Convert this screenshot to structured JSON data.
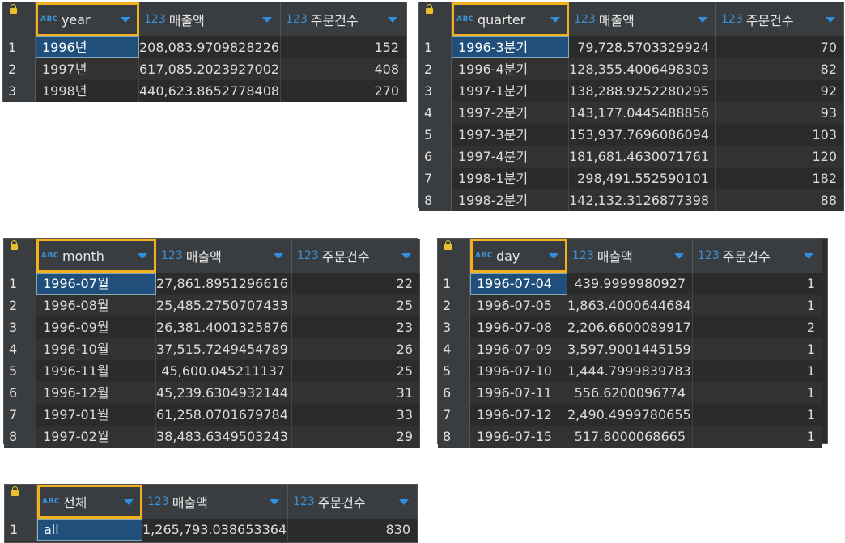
{
  "grids": {
    "year": {
      "col1_type": "ABC",
      "col1_name": "year",
      "col2_type": "123",
      "col2_name": "매출액",
      "col3_type": "123",
      "col3_name": "주문건수",
      "rows": [
        {
          "n": "1",
          "a": "1996년",
          "b": "208,083.9709828226",
          "c": "152"
        },
        {
          "n": "2",
          "a": "1997년",
          "b": "617,085.2023927002",
          "c": "408"
        },
        {
          "n": "3",
          "a": "1998년",
          "b": "440,623.8652778408",
          "c": "270"
        }
      ]
    },
    "quarter": {
      "col1_type": "ABC",
      "col1_name": "quarter",
      "col2_type": "123",
      "col2_name": "매출액",
      "col3_type": "123",
      "col3_name": "주문건수",
      "rows": [
        {
          "n": "1",
          "a": "1996-3분기",
          "b": "79,728.5703329924",
          "c": "70"
        },
        {
          "n": "2",
          "a": "1996-4분기",
          "b": "128,355.4006498303",
          "c": "82"
        },
        {
          "n": "3",
          "a": "1997-1분기",
          "b": "138,288.9252280295",
          "c": "92"
        },
        {
          "n": "4",
          "a": "1997-2분기",
          "b": "143,177.0445488856",
          "c": "93"
        },
        {
          "n": "5",
          "a": "1997-3분기",
          "b": "153,937.7696086094",
          "c": "103"
        },
        {
          "n": "6",
          "a": "1997-4분기",
          "b": "181,681.4630071761",
          "c": "120"
        },
        {
          "n": "7",
          "a": "1998-1분기",
          "b": "298,491.552590101",
          "c": "182"
        },
        {
          "n": "8",
          "a": "1998-2분기",
          "b": "142,132.3126877398",
          "c": "88"
        }
      ]
    },
    "month": {
      "col1_type": "ABC",
      "col1_name": "month",
      "col2_type": "123",
      "col2_name": "매출액",
      "col3_type": "123",
      "col3_name": "주문건수",
      "rows": [
        {
          "n": "1",
          "a": "1996-07월",
          "b": "27,861.8951296616",
          "c": "22"
        },
        {
          "n": "2",
          "a": "1996-08월",
          "b": "25,485.2750707433",
          "c": "25"
        },
        {
          "n": "3",
          "a": "1996-09월",
          "b": "26,381.4001325876",
          "c": "23"
        },
        {
          "n": "4",
          "a": "1996-10월",
          "b": "37,515.7249454789",
          "c": "26"
        },
        {
          "n": "5",
          "a": "1996-11월",
          "b": "45,600.045211137",
          "c": "25"
        },
        {
          "n": "6",
          "a": "1996-12월",
          "b": "45,239.6304932144",
          "c": "31"
        },
        {
          "n": "7",
          "a": "1997-01월",
          "b": "61,258.0701679784",
          "c": "33"
        },
        {
          "n": "8",
          "a": "1997-02월",
          "b": "38,483.6349503243",
          "c": "29"
        }
      ]
    },
    "day": {
      "col1_type": "ABC",
      "col1_name": "day",
      "col2_type": "123",
      "col2_name": "매출액",
      "col3_type": "123",
      "col3_name": "주문건수",
      "rows": [
        {
          "n": "1",
          "a": "1996-07-04",
          "b": "439.9999980927",
          "c": "1"
        },
        {
          "n": "2",
          "a": "1996-07-05",
          "b": "1,863.4000644684",
          "c": "1"
        },
        {
          "n": "3",
          "a": "1996-07-08",
          "b": "2,206.6600089917",
          "c": "2"
        },
        {
          "n": "4",
          "a": "1996-07-09",
          "b": "3,597.9001445159",
          "c": "1"
        },
        {
          "n": "5",
          "a": "1996-07-10",
          "b": "1,444.7999839783",
          "c": "1"
        },
        {
          "n": "6",
          "a": "1996-07-11",
          "b": "556.6200096774",
          "c": "1"
        },
        {
          "n": "7",
          "a": "1996-07-12",
          "b": "2,490.4999780655",
          "c": "1"
        },
        {
          "n": "8",
          "a": "1996-07-15",
          "b": "517.8000068665",
          "c": "1"
        }
      ]
    },
    "total": {
      "col1_type": "ABC",
      "col1_name": "전체",
      "col2_type": "123",
      "col2_name": "매출액",
      "col3_type": "123",
      "col3_name": "주문건수",
      "rows": [
        {
          "n": "1",
          "a": "all",
          "b": "1,265,793.038653364",
          "c": "830"
        }
      ]
    }
  }
}
